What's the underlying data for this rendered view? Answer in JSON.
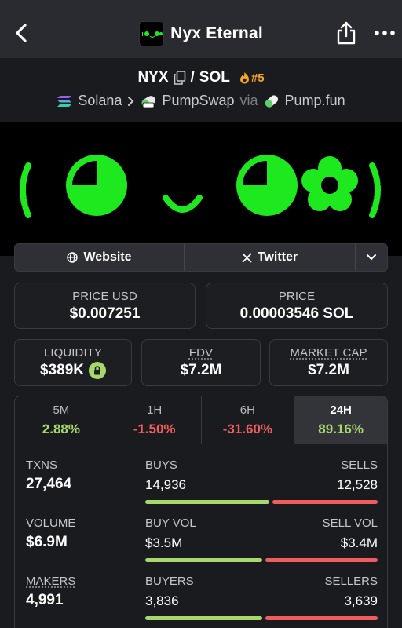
{
  "header": {
    "title": "Nyx Eternal",
    "back_icon": "chevron-left-icon",
    "share_icon": "share-icon",
    "more_icon": "more-dots-icon"
  },
  "pair": {
    "base": "NYX",
    "separator": "/",
    "quote": "SOL",
    "rank": "#5",
    "chain": "Solana",
    "dex": "PumpSwap",
    "via": "via",
    "launchpad": "Pump.fun"
  },
  "links": {
    "website": "Website",
    "twitter": "Twitter"
  },
  "prices": {
    "price_usd_label": "PRICE USD",
    "price_usd": "$0.007251",
    "price_label": "PRICE",
    "price_sol": "0.00003546 SOL"
  },
  "metrics": {
    "liquidity_label": "LIQUIDITY",
    "liquidity": "$389K",
    "fdv_label": "FDV",
    "fdv": "$7.2M",
    "mcap_label": "MARKET CAP",
    "mcap": "$7.2M"
  },
  "tabs": [
    {
      "label": "5M",
      "value": "2.88%",
      "trend": "up"
    },
    {
      "label": "1H",
      "value": "-1.50%",
      "trend": "down"
    },
    {
      "label": "6H",
      "value": "-31.60%",
      "trend": "down"
    },
    {
      "label": "24H",
      "value": "89.16%",
      "trend": "up",
      "active": true
    }
  ],
  "stats": {
    "txns_label": "TXNS",
    "txns": "27,464",
    "volume_label": "VOLUME",
    "volume": "$6.9M",
    "makers_label": "MAKERS",
    "makers": "4,991",
    "buys_label": "BUYS",
    "buys": "14,936",
    "sells_label": "SELLS",
    "sells": "12,528",
    "buys_fraction": 0.54,
    "buy_vol_label": "BUY VOL",
    "buy_vol": "$3.5M",
    "sell_vol_label": "SELL VOL",
    "sell_vol": "$3.4M",
    "buy_vol_fraction": 0.51,
    "buyers_label": "BUYERS",
    "buyers": "3,836",
    "sellers_label": "SELLERS",
    "sellers": "3,639",
    "buyers_fraction": 0.51
  },
  "colors": {
    "positive": "#a6d86b",
    "negative": "#ef5d5d",
    "accent_orange": "#f5a623",
    "banner_green": "#1ee81e"
  }
}
